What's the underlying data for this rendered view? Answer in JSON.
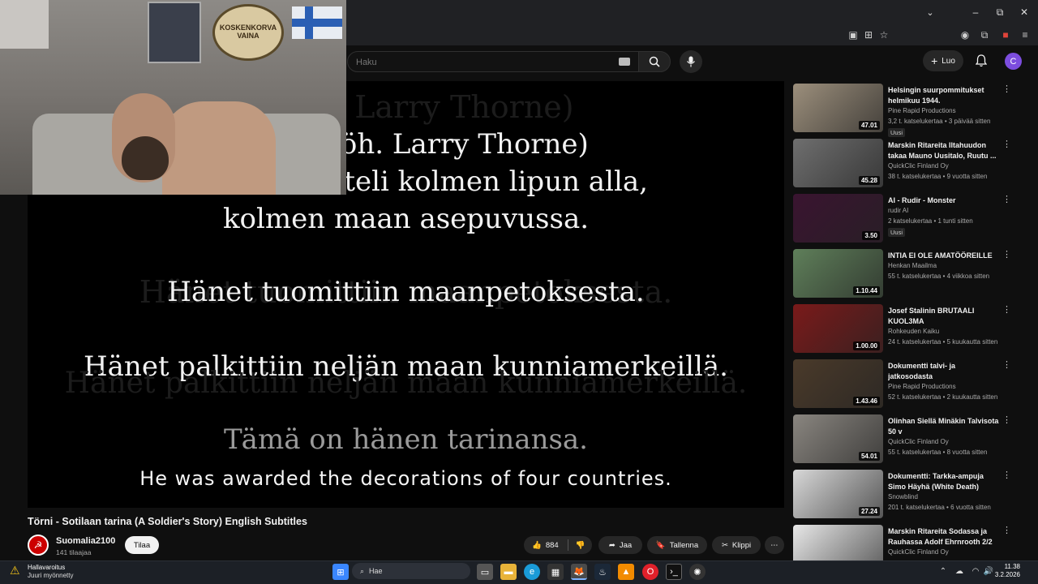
{
  "browser": {
    "window_controls": [
      "chevron-down",
      "minimize",
      "restore",
      "close"
    ]
  },
  "header": {
    "search_placeholder": "Haku",
    "create_label": "Luo",
    "avatar_letter": "C"
  },
  "webcam": {
    "poster_text": "KOSKENKORVA VAINA"
  },
  "video": {
    "subs": {
      "ghost_top": "(myöh. Larry Thorne)",
      "line1": "(myöh. Larry Thorne)",
      "line2": "taisteli kolmen lipun alla,",
      "line3": "kolmen maan asepuvussa.",
      "ghost_mid": "Hänet tuomittiin maanpetoksesta.",
      "line4": "Hänet tuomittiin maanpetoksesta.",
      "line5": "Hänet palkittiin neljän maan kunniamerkeillä.",
      "ghost_low": "Hänet palkittiin neljän maan kunniamerkeillä.",
      "line6": "Tämä on hänen tarinansa.",
      "english": "He was awarded the decorations of four countries."
    },
    "title": "Törni - Sotilaan tarina (A Soldier's Story) English Subtitles",
    "channel": {
      "name": "Suomalia2100",
      "subscribers": "141 tilaajaa",
      "subscribe_label": "Tilaa"
    },
    "actions": {
      "likes": "884",
      "share": "Jaa",
      "save": "Tallenna",
      "clip": "Klippi"
    }
  },
  "recommendations": [
    {
      "title": "Helsingin suurpommitukset helmikuu 1944.",
      "channel": "Pine Rapid Productions",
      "meta": "3,2 t. katselukertaa • 3 päivää sitten",
      "duration": "47.01",
      "badge": "Uusi",
      "color": "#9c8f7c"
    },
    {
      "title": "Marskin Ritareita Iltahuudon takaa Mauno Uusitalo, Ruutu ...",
      "channel": "QuickClic Finland Oy",
      "meta": "38 t. katselukertaa • 9 vuotta sitten",
      "duration": "45.28",
      "badge": "",
      "color": "#6f6f6f"
    },
    {
      "title": "AI - Rudir - Monster",
      "channel": "rudir AI",
      "meta": "2 katselukertaa • 1 tunti sitten",
      "duration": "3.50",
      "badge": "Uusi",
      "color": "#3a1430"
    },
    {
      "title": "INTIA EI OLE AMATÖÖREILLE",
      "channel": "Henkan Maailma",
      "meta": "55 t. katselukertaa • 4 viikkoa sitten",
      "duration": "1.10.44",
      "badge": "",
      "color": "#5f7f5a"
    },
    {
      "title": "Josef Stalinin BRUTAALI KUOL3MA",
      "channel": "Rohkeuden Kaiku",
      "meta": "24 t. katselukertaa • 5 kuukautta sitten",
      "duration": "1.00.00",
      "badge": "",
      "color": "#7a1a1a"
    },
    {
      "title": "Dokumentti talvi- ja jatkosodasta",
      "channel": "Pine Rapid Productions",
      "meta": "52 t. katselukertaa • 2 kuukautta sitten",
      "duration": "1.43.46",
      "badge": "",
      "color": "#4a3a2a"
    },
    {
      "title": "Olinhan Siellä Minäkin Talvisota 50 v",
      "channel": "QuickClic Finland Oy",
      "meta": "55 t. katselukertaa • 8 vuotta sitten",
      "duration": "54.01",
      "badge": "",
      "color": "#8a8680"
    },
    {
      "title": "Dokumentti: Tarkka-ampuja Simo Häyhä (White Death)",
      "channel": "Snowblind",
      "meta": "201 t. katselukertaa • 6 vuotta sitten",
      "duration": "27.24",
      "badge": "",
      "color": "#d8d8d8"
    },
    {
      "title": "Marskin Ritareita Sodassa ja Rauhassa Adolf Ehrnrooth 2/2",
      "channel": "QuickClic Finland Oy",
      "meta": "",
      "duration": "",
      "badge": "",
      "color": "#e8e8e8"
    }
  ],
  "taskbar": {
    "notice_title": "Hallavaroitus",
    "notice_sub": "Juuri myönnetty",
    "search_label": "Hae",
    "time": "11.38",
    "date": "3.2.2026"
  }
}
